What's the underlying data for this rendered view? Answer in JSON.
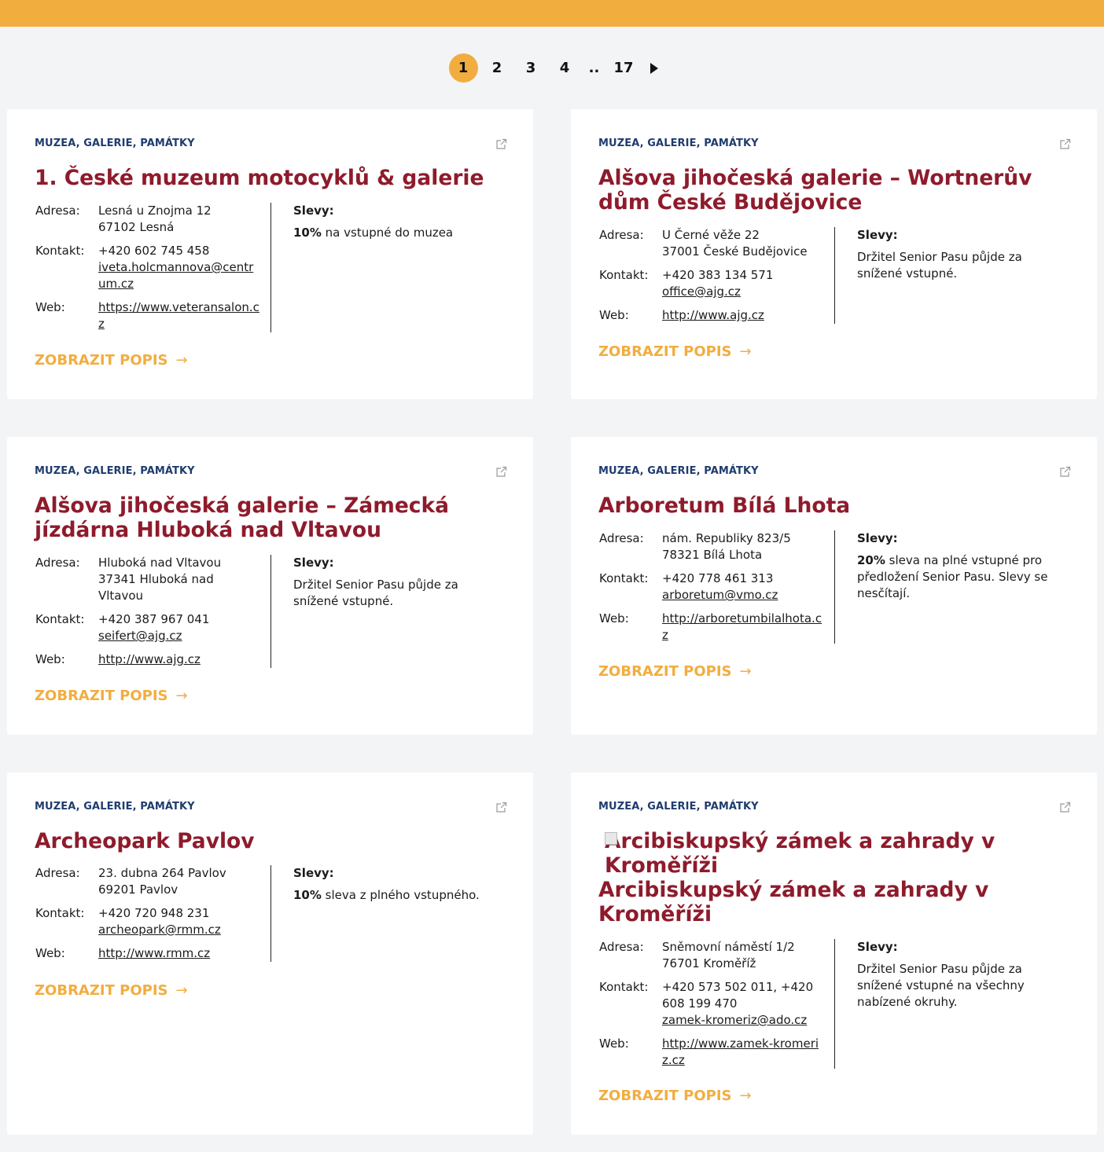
{
  "pagination": {
    "pages": [
      "1",
      "2",
      "3",
      "4",
      "..",
      "17"
    ],
    "active": "1"
  },
  "cards": [
    {
      "category": "MUZEA, GALERIE, PAMÁTKY",
      "title": "1. České muzeum motocyklů & galerie",
      "address_label": "Adresa:",
      "address": [
        "Lesná u Znojma 12",
        "67102 Lesná"
      ],
      "contact_label": "Kontakt:",
      "phone": "+420 602 745 458",
      "email": "iveta.holcmannova@centrum.cz",
      "web_label": "Web:",
      "web": "https://www.veteransalon.cz",
      "discount_label": "Slevy:",
      "discount_bold": "10%",
      "discount_text": " na vstupné do muzea",
      "button": "ZOBRAZIT POPIS"
    },
    {
      "category": "MUZEA, GALERIE, PAMÁTKY",
      "title": "Alšova jihočeská galerie – Wortnerův dům České Budějovice",
      "address_label": "Adresa:",
      "address": [
        "U Černé věže 22",
        "37001 České Budějovice"
      ],
      "contact_label": "Kontakt:",
      "phone": "+420 383 134 571",
      "email": "office@ajg.cz",
      "web_label": "Web:",
      "web": "http://www.ajg.cz",
      "discount_label": "Slevy:",
      "discount_bold": "",
      "discount_text": "Držitel Senior Pasu půjde za snížené vstupné.",
      "button": "ZOBRAZIT POPIS"
    },
    {
      "category": "MUZEA, GALERIE, PAMÁTKY",
      "title": "Alšova jihočeská galerie – Zámecká jízdárna Hluboká nad Vltavou",
      "address_label": "Adresa:",
      "address": [
        "Hluboká nad Vltavou",
        "37341 Hluboká nad Vltavou"
      ],
      "contact_label": "Kontakt:",
      "phone": "+420 387 967 041",
      "email": "seifert@ajg.cz",
      "web_label": "Web:",
      "web": "http://www.ajg.cz",
      "discount_label": "Slevy:",
      "discount_bold": "",
      "discount_text": "Držitel Senior Pasu půjde za snížené vstupné.",
      "button": "ZOBRAZIT POPIS"
    },
    {
      "category": "MUZEA, GALERIE, PAMÁTKY",
      "title": "Arboretum Bílá Lhota",
      "address_label": "Adresa:",
      "address": [
        "nám. Republiky 823/5",
        "78321 Bílá Lhota"
      ],
      "contact_label": "Kontakt:",
      "phone": "+420 778 461 313",
      "email": "arboretum@vmo.cz",
      "web_label": "Web:",
      "web": "http://arboretumbilalhota.cz",
      "discount_label": "Slevy:",
      "discount_bold": "20%",
      "discount_text": " sleva na plné vstupné pro předložení Senior Pasu. Slevy se nesčítají.",
      "button": "ZOBRAZIT POPIS"
    },
    {
      "category": "MUZEA, GALERIE, PAMÁTKY",
      "title": "Archeopark Pavlov",
      "address_label": "Adresa:",
      "address": [
        "23. dubna 264 Pavlov",
        "69201 Pavlov"
      ],
      "contact_label": "Kontakt:",
      "phone": "+420 720 948 231",
      "email": "archeopark@rmm.cz",
      "web_label": "Web:",
      "web": "http://www.rmm.cz",
      "discount_label": "Slevy:",
      "discount_bold": "10%",
      "discount_text": " sleva z plného vstupného.",
      "button": "ZOBRAZIT POPIS"
    },
    {
      "category": "MUZEA, GALERIE, PAMÁTKY",
      "image_alt": "Arcibiskupský zámek a zahrady v Kroměříži",
      "title": "Arcibiskupský zámek a zahrady v Kroměříži",
      "address_label": "Adresa:",
      "address": [
        "Sněmovní náměstí 1/2",
        "76701 Kroměříž"
      ],
      "contact_label": "Kontakt:",
      "phone": "+420 573 502 011, +420 608 199 470",
      "email": "zamek-kromeriz@ado.cz",
      "web_label": "Web:",
      "web": "http://www.zamek-kromeriz.cz",
      "discount_label": "Slevy:",
      "discount_bold": "",
      "discount_text": "Držitel Senior Pasu půjde za snížené vstupné na všechny nabízené okruhy.",
      "button": "ZOBRAZIT POPIS"
    }
  ]
}
